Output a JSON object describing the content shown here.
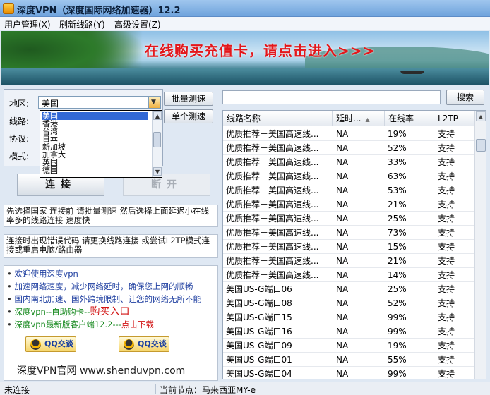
{
  "window": {
    "title": "深度VPN（深度国际网络加速器）12.2"
  },
  "menu": [
    "用户管理(X)",
    "刷新线路(Y)",
    "高级设置(Z)"
  ],
  "banner": {
    "text": "在线购买充值卡，请点击进入>>>"
  },
  "settings": {
    "region_label": "地区:",
    "line_label": "线路:",
    "protocol_label": "协议:",
    "mode_label": "模式:",
    "region_value": "美国",
    "region_options": [
      "美国",
      "香港",
      "台湾",
      "日本",
      "新加坡",
      "加拿大",
      "英国",
      "德国"
    ]
  },
  "buttons": {
    "batch_test": "批量测速",
    "single_test": "单个测速",
    "connect": "连接",
    "disconnect": "断开",
    "search": "搜索"
  },
  "tips": {
    "tip1": "先选择国家 连接前 请批量测速 然后选择上面延迟小在线率多的线路连接 速度快",
    "tip2": "连接时出现错误代码 请更换线路连接 或尝试L2TP模式连接或重启电脑/路由器"
  },
  "news": {
    "line1": "欢迎使用深度vpn",
    "line2": "加速网络速度，减少网络延时，确保您上网的顺畅",
    "line3": "国内南北加速、国外跨境限制、让您的网络无所不能",
    "line4a": "深度vpn--自助购卡--",
    "line4b": "购买入口",
    "line5a": "深度vpn最新版客户端12.2---",
    "line5b": "点击下载",
    "qq1": "QQ交谈",
    "qq2": "QQ交谈",
    "site": "深度VPN官网 www.shenduvpn.com"
  },
  "table": {
    "headers": {
      "name": "线路名称",
      "delay": "延时...",
      "rate": "在线率",
      "l2tp": "L2TP"
    },
    "rows": [
      {
        "name": "优质推荐－美国高速线...",
        "delay": "NA",
        "rate": "19%",
        "l2tp": "支持"
      },
      {
        "name": "优质推荐－美国高速线...",
        "delay": "NA",
        "rate": "52%",
        "l2tp": "支持"
      },
      {
        "name": "优质推荐－美国高速线...",
        "delay": "NA",
        "rate": "33%",
        "l2tp": "支持"
      },
      {
        "name": "优质推荐－美国高速线...",
        "delay": "NA",
        "rate": "63%",
        "l2tp": "支持"
      },
      {
        "name": "优质推荐－美国高速线...",
        "delay": "NA",
        "rate": "53%",
        "l2tp": "支持"
      },
      {
        "name": "优质推荐－美国高速线...",
        "delay": "NA",
        "rate": "21%",
        "l2tp": "支持"
      },
      {
        "name": "优质推荐－美国高速线...",
        "delay": "NA",
        "rate": "25%",
        "l2tp": "支持"
      },
      {
        "name": "优质推荐－美国高速线...",
        "delay": "NA",
        "rate": "73%",
        "l2tp": "支持"
      },
      {
        "name": "优质推荐－美国高速线...",
        "delay": "NA",
        "rate": "15%",
        "l2tp": "支持"
      },
      {
        "name": "优质推荐－美国高速线...",
        "delay": "NA",
        "rate": "21%",
        "l2tp": "支持"
      },
      {
        "name": "优质推荐－美国高速线...",
        "delay": "NA",
        "rate": "14%",
        "l2tp": "支持"
      },
      {
        "name": "美国US-G端口06",
        "delay": "NA",
        "rate": "25%",
        "l2tp": "支持"
      },
      {
        "name": "美国US-G端口08",
        "delay": "NA",
        "rate": "52%",
        "l2tp": "支持"
      },
      {
        "name": "美国US-G端口15",
        "delay": "NA",
        "rate": "99%",
        "l2tp": "支持"
      },
      {
        "name": "美国US-G端口16",
        "delay": "NA",
        "rate": "99%",
        "l2tp": "支持"
      },
      {
        "name": "美国US-G端口09",
        "delay": "NA",
        "rate": "19%",
        "l2tp": "支持"
      },
      {
        "name": "美国US-G端口01",
        "delay": "NA",
        "rate": "55%",
        "l2tp": "支持"
      },
      {
        "name": "美国US-G端口04",
        "delay": "NA",
        "rate": "99%",
        "l2tp": "支持"
      }
    ]
  },
  "status": {
    "connection": "未连接",
    "node_label": "当前节点：",
    "node_value": "马来西亚MY-e"
  }
}
